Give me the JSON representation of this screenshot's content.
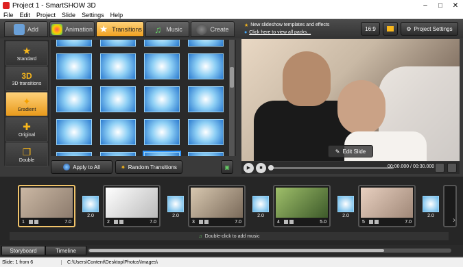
{
  "window": {
    "title": "Project 1 - SmartSHOW 3D",
    "minimize": "–",
    "maximize": "□",
    "close": "✕"
  },
  "menu": [
    "File",
    "Edit",
    "Project",
    "Slide",
    "Settings",
    "Help"
  ],
  "tabs": [
    {
      "label": "Add",
      "icon": "add-photo-icon",
      "active": false
    },
    {
      "label": "Animation",
      "icon": "palette-icon",
      "active": false
    },
    {
      "label": "Transitions",
      "icon": "star-icon",
      "active": true
    },
    {
      "label": "Music",
      "icon": "music-note-icon",
      "active": false
    },
    {
      "label": "Create",
      "icon": "film-reel-icon",
      "active": false
    }
  ],
  "news": {
    "line1": "New slideshow templates and effects",
    "line2": "Click here to view all packs..."
  },
  "top_buttons": {
    "aspect": "16:9",
    "project_settings": "Project Settings"
  },
  "categories": [
    {
      "label": "Standard",
      "icon": "star-icon",
      "glyph": "★",
      "active": false
    },
    {
      "label": "3D transitions",
      "icon": "3d-icon",
      "glyph": "3D",
      "active": false
    },
    {
      "label": "Gradient",
      "icon": "gradient-icon",
      "glyph": "✦",
      "active": true
    },
    {
      "label": "Original",
      "icon": "puzzle-icon",
      "glyph": "✚",
      "active": false
    },
    {
      "label": "Double",
      "icon": "double-icon",
      "glyph": "❐",
      "active": false
    }
  ],
  "bottom_buttons": {
    "apply_all": "Apply to All",
    "random": "Random Transitions"
  },
  "preview": {
    "edit_slide": "Edit Slide"
  },
  "player": {
    "time": "00:00.000 / 00:30.000",
    "progress": 0
  },
  "slides": [
    {
      "num": "1",
      "duration": "7.0",
      "transition": "2.0",
      "active": true
    },
    {
      "num": "2",
      "duration": "7.0",
      "transition": "2.0",
      "active": false
    },
    {
      "num": "3",
      "duration": "7.0",
      "transition": "2.0",
      "active": false
    },
    {
      "num": "4",
      "duration": "5.0",
      "transition": "2.0",
      "active": false
    },
    {
      "num": "5",
      "duration": "7.0",
      "transition": "2.0",
      "active": false
    }
  ],
  "music": {
    "label": "Double-click to add music"
  },
  "bottom_tabs": {
    "storyboard": "Storyboard",
    "timeline": "Timeline"
  },
  "status": {
    "slide": "Slide: 1 from 6",
    "path": "C:\\Users\\Content\\Desktop\\Photos\\Images\\"
  }
}
